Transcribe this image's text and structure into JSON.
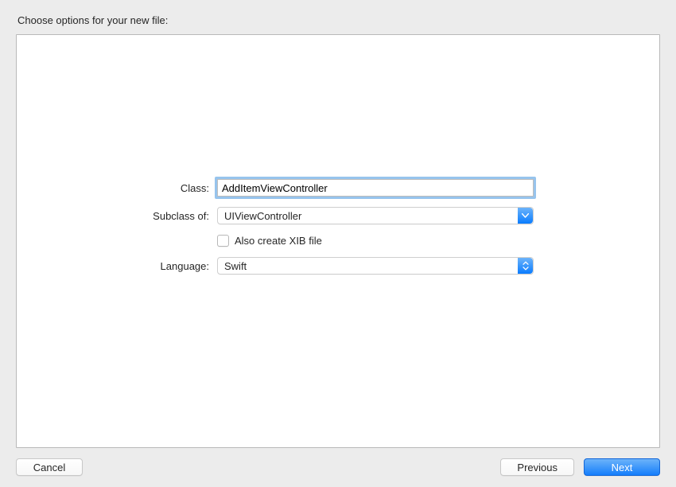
{
  "title": "Choose options for your new file:",
  "form": {
    "class_label": "Class:",
    "class_value": "AddItemViewController",
    "subclass_label": "Subclass of:",
    "subclass_value": "UIViewController",
    "xib_label": "Also create XIB file",
    "xib_checked": false,
    "language_label": "Language:",
    "language_value": "Swift"
  },
  "buttons": {
    "cancel": "Cancel",
    "previous": "Previous",
    "next": "Next"
  }
}
